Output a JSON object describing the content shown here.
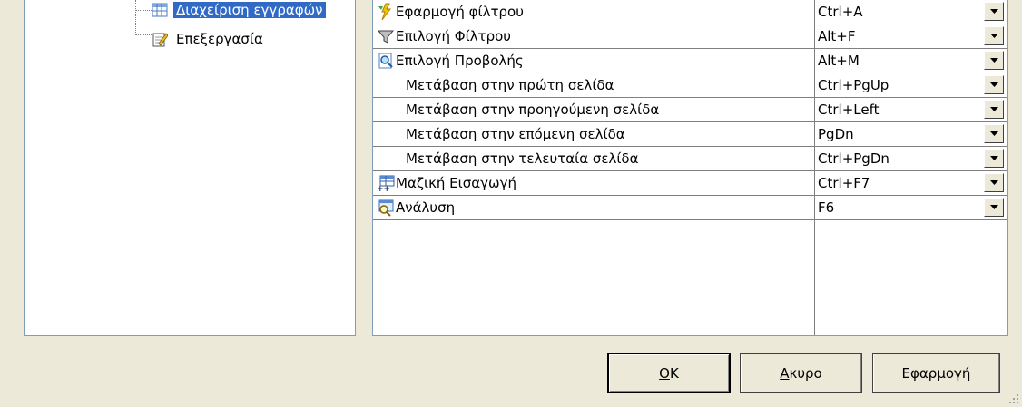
{
  "tree": {
    "items": [
      {
        "label": "Διαχείριση εγγραφών",
        "icon": "table-icon",
        "selected": true
      },
      {
        "label": "Επεξεργασία",
        "icon": "edit-icon",
        "selected": false
      }
    ]
  },
  "shortcuts": [
    {
      "name": "Εφαρμογή φίλτρου",
      "key": "Ctrl+A",
      "icon": "filter-apply-icon"
    },
    {
      "name": "Επιλογή Φίλτρου",
      "key": "Alt+F",
      "icon": "funnel-icon"
    },
    {
      "name": "Επιλογή Προβολής",
      "key": "Alt+M",
      "icon": "view-icon"
    },
    {
      "name": "Μετάβαση στην πρώτη σελίδα",
      "key": "Ctrl+PgUp",
      "icon": null
    },
    {
      "name": "Μετάβαση στην προηγούμενη σελίδα",
      "key": "Ctrl+Left",
      "icon": null
    },
    {
      "name": "Μετάβαση στην επόμενη σελίδα",
      "key": "PgDn",
      "icon": null
    },
    {
      "name": "Μετάβαση στην τελευταία σελίδα",
      "key": "Ctrl+PgDn",
      "icon": null
    },
    {
      "name": "Μαζική Εισαγωγή",
      "key": "Ctrl+F7",
      "icon": "bulk-insert-icon"
    },
    {
      "name": "Ανάλυση",
      "key": "F6",
      "icon": "analysis-icon"
    }
  ],
  "buttons": {
    "ok_mnemonic": "O",
    "ok_rest": "K",
    "cancel_mnemonic": "Α",
    "cancel_rest": "κυρο",
    "apply": "Εφαρμογή"
  }
}
